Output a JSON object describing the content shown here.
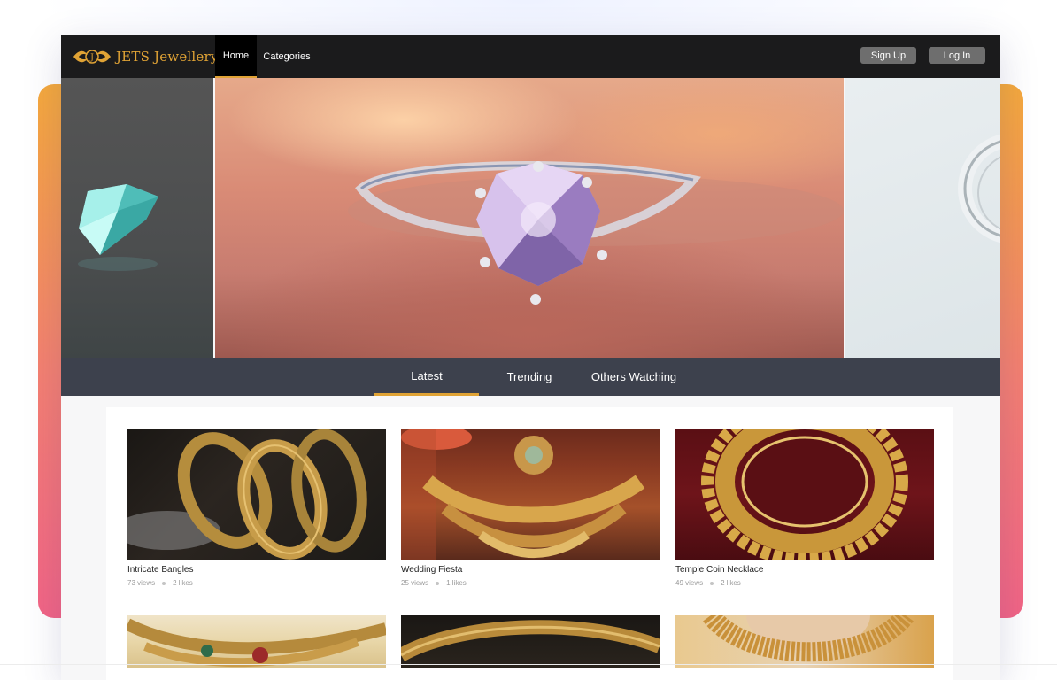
{
  "brand": {
    "name": "JETS Jewellery",
    "accent": "#e0a335"
  },
  "nav": {
    "tabs": [
      {
        "label": "Home",
        "active": true
      },
      {
        "label": "Categories",
        "active": false
      }
    ],
    "signup_label": "Sign Up",
    "login_label": "Log In"
  },
  "carousel": {
    "slides": [
      "diamond",
      "diamond-ring",
      "silver-ring"
    ]
  },
  "tabs": [
    {
      "label": "Latest",
      "active": true
    },
    {
      "label": "Trending",
      "active": false
    },
    {
      "label": "Others Watching",
      "active": false
    }
  ],
  "items": [
    {
      "title": "Intricate Bangles",
      "views": "73 views",
      "likes": "2 likes"
    },
    {
      "title": "Wedding Fiesta",
      "views": "25 views",
      "likes": "1 likes"
    },
    {
      "title": "Temple Coin Necklace",
      "views": "49 views",
      "likes": "2 likes"
    }
  ],
  "colors": {
    "navbar": "#1b1b1c",
    "tabstrip": "#3d414d",
    "gradient_top": "#f5a93c",
    "gradient_bottom": "#f26486"
  }
}
